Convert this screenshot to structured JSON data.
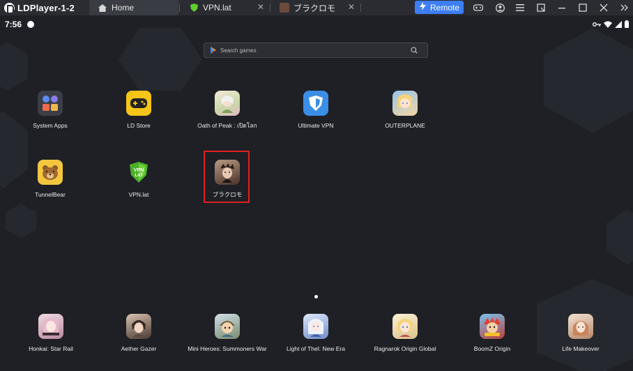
{
  "window": {
    "title": "LDPlayer-1-2",
    "tabs": [
      {
        "label": "Home",
        "icon": "home-icon"
      },
      {
        "label": "VPN.lat",
        "icon": "vpn-shield-icon"
      },
      {
        "label": "ブラクロモ",
        "icon": "game-thumbnail-icon"
      }
    ],
    "close_glyph": "✕",
    "remote_label": "Remote"
  },
  "status": {
    "time": "7:56"
  },
  "search": {
    "placeholder": "Search games"
  },
  "apps": [
    {
      "label": "System Apps",
      "color": "#3b3e47"
    },
    {
      "label": "LD Store",
      "color": "#f5c518"
    },
    {
      "label": "Oath of Peak : เปิดโลก",
      "color": "#e8d8c4"
    },
    {
      "label": "Ultimate VPN",
      "color": "#3a8ee6"
    },
    {
      "label": "OUTERPLANE",
      "color": "#cdb47c"
    },
    {
      "label": "TunnelBear",
      "color": "#f3c63f"
    },
    {
      "label": "VPN.lat",
      "color": "#4caf2a"
    },
    {
      "label": "ブラクロモ",
      "color": "#6b4a3a"
    }
  ],
  "dock": [
    {
      "label": "Honkai: Star Rail",
      "color": "#c9a8b8"
    },
    {
      "label": "Aether Gazer",
      "color": "#6a5448"
    },
    {
      "label": "Mini Heroes: Summoners War",
      "color": "#7a8a6e"
    },
    {
      "label": "Light of Thel: New Era",
      "color": "#8eaed8"
    },
    {
      "label": "Ragnarok Origin Global",
      "color": "#e9d9a0"
    },
    {
      "label": "BoomZ Origin",
      "color": "#b9423a"
    },
    {
      "label": "Life Makeover",
      "color": "#d8b7a0"
    }
  ]
}
